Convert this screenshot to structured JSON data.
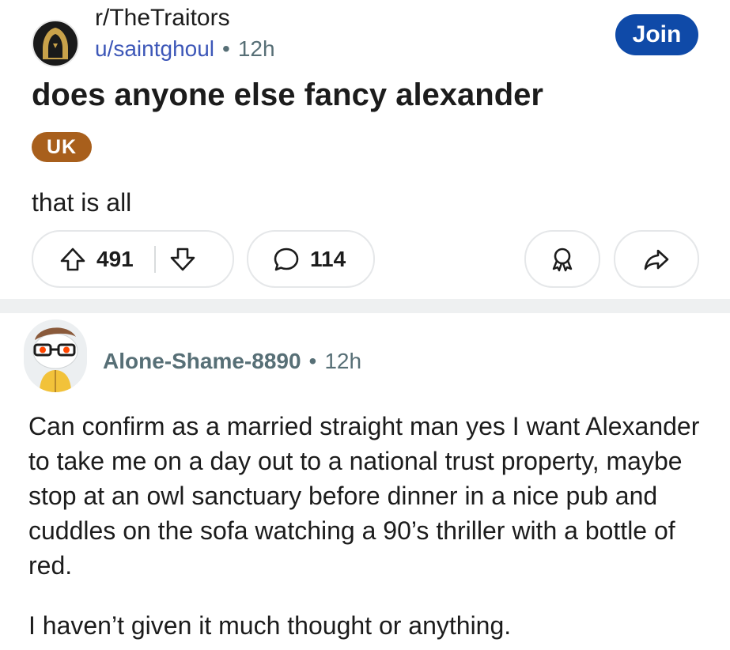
{
  "post": {
    "subreddit": "r/TheTraitors",
    "author": "u/saintghoul",
    "separator": "•",
    "time": "12h",
    "join_label": "Join",
    "title": "does anyone else fancy alexander",
    "flair": "UK",
    "body": "that is all",
    "upvotes": "491",
    "comments": "114"
  },
  "comment": {
    "author": "Alone-Shame-8890",
    "separator": "•",
    "time": "12h",
    "paragraphs": [
      "Can confirm as a married straight man yes I want Alexander to take me on a day out to a national trust property, maybe stop at an owl sanctuary before dinner in a nice pub and cuddles on the sofa watching a 90’s thriller with a bottle of red.",
      "I haven’t given it much thought or anything."
    ]
  },
  "colors": {
    "join_button": "#0f4aa8",
    "flair": "#a85f1c",
    "username": "#3d57b8",
    "meta": "#576f76"
  },
  "icons": {
    "subreddit": "hooded-figure-icon",
    "upvote": "arrow-up-icon",
    "downvote": "arrow-down-icon",
    "comment": "speech-bubble-icon",
    "award": "award-icon",
    "share": "share-arrow-icon",
    "comment_avatar": "snoo-avatar-icon"
  }
}
